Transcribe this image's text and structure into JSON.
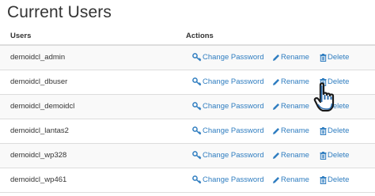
{
  "page": {
    "title": "Current Users"
  },
  "table": {
    "headers": {
      "users": "Users",
      "actions": "Actions"
    },
    "rows": [
      {
        "user": "demoidcl_admin"
      },
      {
        "user": "demoidcl_dbuser"
      },
      {
        "user": "demoidcl_demoidcl"
      },
      {
        "user": "demoidcl_lantas2"
      },
      {
        "user": "demoidcl_wp328"
      },
      {
        "user": "demoidcl_wp461"
      }
    ],
    "actions": {
      "change_password": "Change Password",
      "rename": "Rename",
      "delete": "Delete"
    }
  },
  "icons": {
    "change_password": "key-icon",
    "rename": "pencil-icon",
    "delete": "trash-icon",
    "cursor": "hand-pointer-cursor"
  },
  "colors": {
    "link": "#2f7dc0",
    "text": "#333333",
    "border": "#dddddd",
    "stripe": "#f9f9f9"
  }
}
